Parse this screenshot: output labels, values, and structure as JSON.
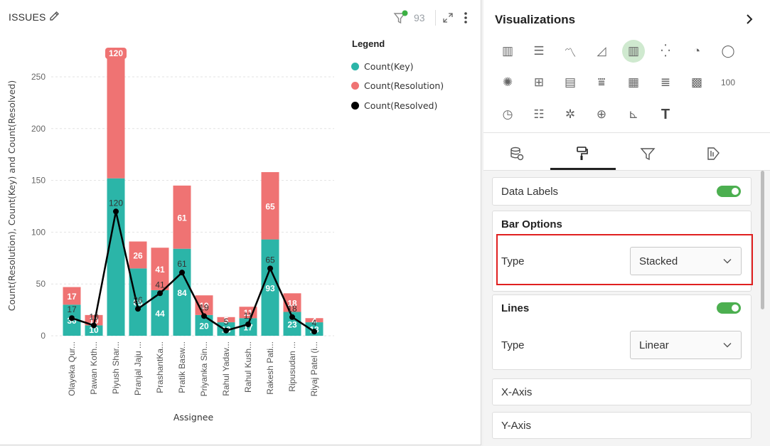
{
  "chart_panel": {
    "title": "ISSUES",
    "filter_count": "93"
  },
  "chart_data": {
    "type": "bar",
    "stacked": true,
    "categories": [
      "Olayeka Qur...",
      "Pawan Koth...",
      "Piyush Shar...",
      "Pranjal Jaju ...",
      "PrashantKa...",
      "Pratik Basw...",
      "Priyanka Sin...",
      "Rahul Yadav...",
      "Rahul Kush...",
      "Rakesh Pati...",
      "Ripusudan ...",
      "Riyaj Patel (i..."
    ],
    "series": [
      {
        "name": "Count(Key)",
        "kind": "bar",
        "color": "#2bb5a8",
        "values": [
          30,
          10,
          152,
          65,
          44,
          84,
          20,
          13,
          17,
          93,
          23,
          13
        ],
        "labels": [
          "30",
          "10",
          "",
          "65",
          "44",
          "84",
          "20",
          "13",
          "17",
          "93",
          "23",
          "13"
        ]
      },
      {
        "name": "Count(Resolution)",
        "kind": "bar",
        "color": "#ef7373",
        "values": [
          17,
          10,
          120,
          26,
          41,
          61,
          19,
          5,
          11,
          65,
          18,
          4
        ],
        "labels": [
          "17",
          "10",
          "120",
          "26",
          "41",
          "61",
          "19",
          "5",
          "11",
          "65",
          "18",
          "4"
        ]
      },
      {
        "name": "Count(Resolved)",
        "kind": "line",
        "color": "#000000",
        "values": [
          17,
          10,
          120,
          26,
          41,
          61,
          19,
          5,
          11,
          65,
          18,
          4
        ],
        "labels": [
          "17",
          "10",
          "120",
          "26",
          "41",
          "61",
          "19",
          "5",
          "11",
          "65",
          "18",
          "4"
        ]
      }
    ],
    "ylim": [
      0,
      280
    ],
    "yticks": [
      0,
      50,
      100,
      150,
      200,
      250
    ],
    "xlabel": "Assignee",
    "ylabel": "Count(Resolution), Count(Key) and Count(Resolved)",
    "legend_title": "Legend",
    "legend_position": "top-right",
    "grid": true
  },
  "sidebar": {
    "title": "Visualizations",
    "viz_icons": [
      {
        "name": "bar-chart-icon",
        "glyph": "▥"
      },
      {
        "name": "horizontal-bar-icon",
        "glyph": "☰"
      },
      {
        "name": "line-chart-icon",
        "glyph": "〽"
      },
      {
        "name": "area-chart-icon",
        "glyph": "◿"
      },
      {
        "name": "combo-chart-icon",
        "glyph": "▥",
        "active": true
      },
      {
        "name": "scatter-chart-icon",
        "glyph": "⁛"
      },
      {
        "name": "pie-chart-icon",
        "glyph": "◔"
      },
      {
        "name": "donut-chart-icon",
        "glyph": "◯"
      },
      {
        "name": "sunburst-icon",
        "glyph": "✺"
      },
      {
        "name": "pivot-table-icon",
        "glyph": "⊞"
      },
      {
        "name": "card-icon",
        "glyph": "▤"
      },
      {
        "name": "funnel-list-icon",
        "glyph": "⩸"
      },
      {
        "name": "table-icon",
        "glyph": "▦"
      },
      {
        "name": "detail-list-icon",
        "glyph": "≣"
      },
      {
        "name": "grid-tiles-icon",
        "glyph": "▩"
      },
      {
        "name": "kpi-number-icon",
        "glyph": "100"
      },
      {
        "name": "gauge-icon",
        "glyph": "◷"
      },
      {
        "name": "heatmap-icon",
        "glyph": "☷"
      },
      {
        "name": "network-icon",
        "glyph": "✲"
      },
      {
        "name": "map-icon",
        "glyph": "⊕"
      },
      {
        "name": "waterfall-icon",
        "glyph": "⊾"
      },
      {
        "name": "text-icon",
        "glyph": "T"
      }
    ],
    "tabs": [
      {
        "name": "data-tab",
        "icon": "database-icon"
      },
      {
        "name": "format-tab",
        "icon": "paint-roller-icon",
        "active": true
      },
      {
        "name": "filter-tab",
        "icon": "filter-icon"
      },
      {
        "name": "analytics-tab",
        "icon": "analytics-icon"
      }
    ],
    "settings": {
      "data_labels": "Data Labels",
      "bar_options": "Bar Options",
      "bar_type_label": "Type",
      "bar_type_value": "Stacked",
      "lines": "Lines",
      "line_type_label": "Type",
      "line_type_value": "Linear",
      "x_axis": "X-Axis",
      "y_axis": "Y-Axis"
    }
  }
}
